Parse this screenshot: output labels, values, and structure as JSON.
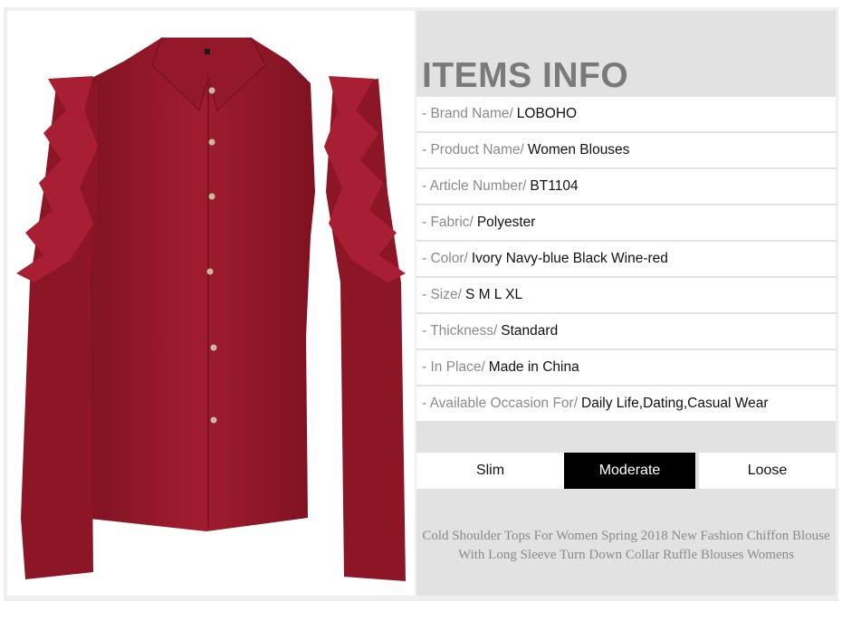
{
  "product_image": {
    "subject": "blouse-photo",
    "color": "#9c1a2b"
  },
  "info": {
    "title": "ITEMS INFO",
    "rows": [
      {
        "label": "- Brand Name/",
        "value": "LOBOHO"
      },
      {
        "label": "- Product Name/",
        "value": "Women Blouses"
      },
      {
        "label": "- Article Number/",
        "value": "BT1104"
      },
      {
        "label": "- Fabric/",
        "value": "Polyester"
      },
      {
        "label": "- Color/",
        "value": "Ivory Navy-blue Black Wine-red"
      },
      {
        "label": "- Size/",
        "value": "S M L XL"
      },
      {
        "label": "- Thickness/",
        "value": "Standard"
      },
      {
        "label": "- In Place/",
        "value": "Made in China"
      },
      {
        "label": "- Available Occasion For/",
        "value": "Daily Life,Dating,Casual Wear"
      }
    ],
    "fit": {
      "options": [
        "Slim",
        "Moderate",
        "Loose"
      ],
      "selected": "Moderate"
    },
    "description": [
      "Cold Shoulder Tops For Women Spring 2018 New Fashion Chiffon Blouse",
      "With Long Sleeve Turn Down Collar Ruffle Blouses Womens"
    ]
  }
}
